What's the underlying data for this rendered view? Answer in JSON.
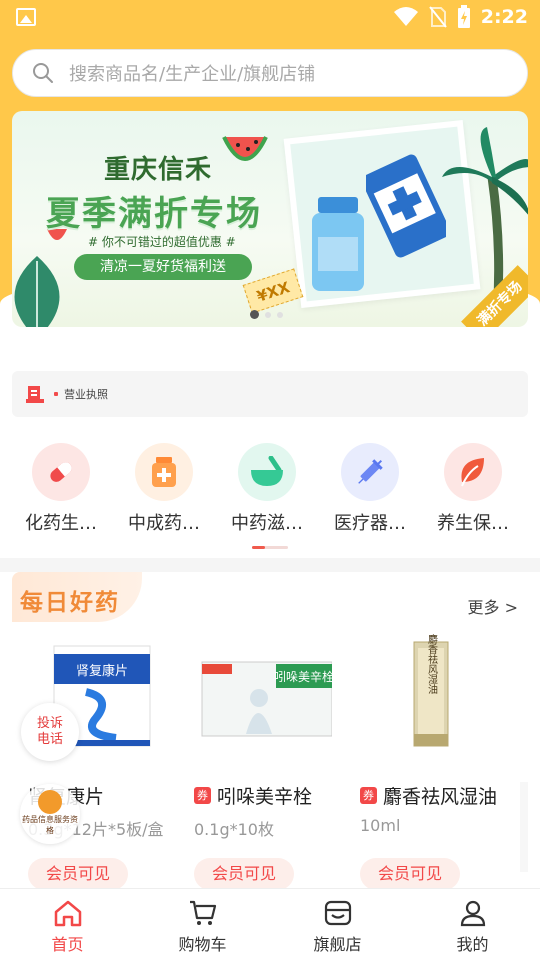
{
  "status_bar": {
    "time": "2:22"
  },
  "search": {
    "placeholder": "搜索商品名/生产企业/旗舰店铺"
  },
  "banner": {
    "title_top": "重庆信禾",
    "title_main": "夏季满折专场",
    "subtitle": "# 你不可错过的超值优惠 #",
    "pill": "清凉一夏好货福利送",
    "price_tag": "¥XX",
    "corner_tag": "满折专场",
    "page_count": 3,
    "active_page": 1
  },
  "license": {
    "label": "营业执照"
  },
  "categories": [
    {
      "label": "化药生…",
      "icon": "capsule-icon",
      "bg": "#fde6e4",
      "color": "#f04b4b"
    },
    {
      "label": "中成药…",
      "icon": "medicine-bottle-icon",
      "bg": "#fff0e2",
      "color": "#ff8a36"
    },
    {
      "label": "中药滋…",
      "icon": "mortar-icon",
      "bg": "#e2f7ef",
      "color": "#2dbf8a"
    },
    {
      "label": "医疗器…",
      "icon": "syringe-icon",
      "bg": "#e8ecfd",
      "color": "#5a78f0"
    },
    {
      "label": "养生保…",
      "icon": "leaf-icon",
      "bg": "#fde6e4",
      "color": "#f05a3c"
    }
  ],
  "daily": {
    "title": "每日好药",
    "more": "更多 >",
    "products": [
      {
        "name": "肾复康片",
        "spec": "0.3g*12片*5板/盒",
        "member": "会员可见",
        "coupon": "",
        "box_text": "肾复康片"
      },
      {
        "name": "吲哚美辛栓",
        "spec": "0.1g*10枚",
        "member": "会员可见",
        "coupon": "券",
        "box_text": "吲哚美辛栓"
      },
      {
        "name": "麝香祛风湿油",
        "spec": "10ml",
        "member": "会员可见",
        "coupon": "券",
        "box_text": "麝香祛风湿油"
      }
    ]
  },
  "floating": {
    "complaint_line1": "投诉",
    "complaint_line2": "电话",
    "seal_text": "药品信息服务资格"
  },
  "bottom_nav": [
    {
      "label": "首页",
      "icon": "home-icon",
      "active": true
    },
    {
      "label": "购物车",
      "icon": "cart-icon",
      "active": false
    },
    {
      "label": "旗舰店",
      "icon": "store-icon",
      "active": false
    },
    {
      "label": "我的",
      "icon": "user-icon",
      "active": false
    }
  ]
}
